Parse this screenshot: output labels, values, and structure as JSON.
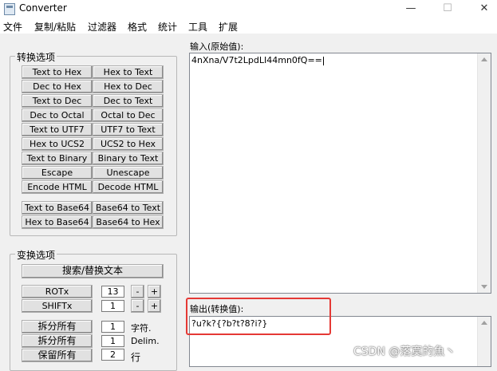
{
  "window": {
    "title": "Converter"
  },
  "menu": [
    "文件",
    "复制/粘贴",
    "过滤器",
    "格式",
    "统计",
    "工具",
    "扩展"
  ],
  "convert_options": {
    "title": "转换选项",
    "buttons": [
      [
        "Text to Hex",
        "Hex to Text"
      ],
      [
        "Dec to Hex",
        "Hex to Dec"
      ],
      [
        "Text to Dec",
        "Dec to Text"
      ],
      [
        "Dec to Octal",
        "Octal to Dec"
      ],
      [
        "Text to UTF7",
        "UTF7 to Text"
      ],
      [
        "Hex to UCS2",
        "UCS2 to Hex"
      ],
      [
        "Text to Binary",
        "Binary to Text"
      ],
      [
        "Escape",
        "Unescape"
      ],
      [
        "Encode HTML",
        "Decode HTML"
      ]
    ],
    "base64_buttons": [
      [
        "Text to Base64",
        "Base64 to Text"
      ],
      [
        "Hex to Base64",
        "Base64 to Hex"
      ]
    ]
  },
  "transform_options": {
    "title": "变换选项",
    "search_replace": "搜索/替换文本",
    "rot": {
      "label": "ROTx",
      "value": "13",
      "minus": "-",
      "plus": "+"
    },
    "shift": {
      "label": "SHIFTx",
      "value": "1",
      "minus": "-",
      "plus": "+"
    },
    "split_all_1": {
      "label": "拆分所有",
      "value": "1",
      "unit": "字符."
    },
    "split_all_2": {
      "label": "拆分所有",
      "value": "1",
      "unit": "Delim."
    },
    "keep_all": {
      "label": "保留所有",
      "value": "2",
      "unit": "行"
    }
  },
  "input": {
    "label": "输入(原始值):",
    "value": "4nXna/V7t2LpdLI44mn0fQ=="
  },
  "output": {
    "label": "输出(转换值):",
    "value": "?u?k?{?b?t?8?i?}"
  },
  "watermark": "CSDN @落寞的魚丶"
}
